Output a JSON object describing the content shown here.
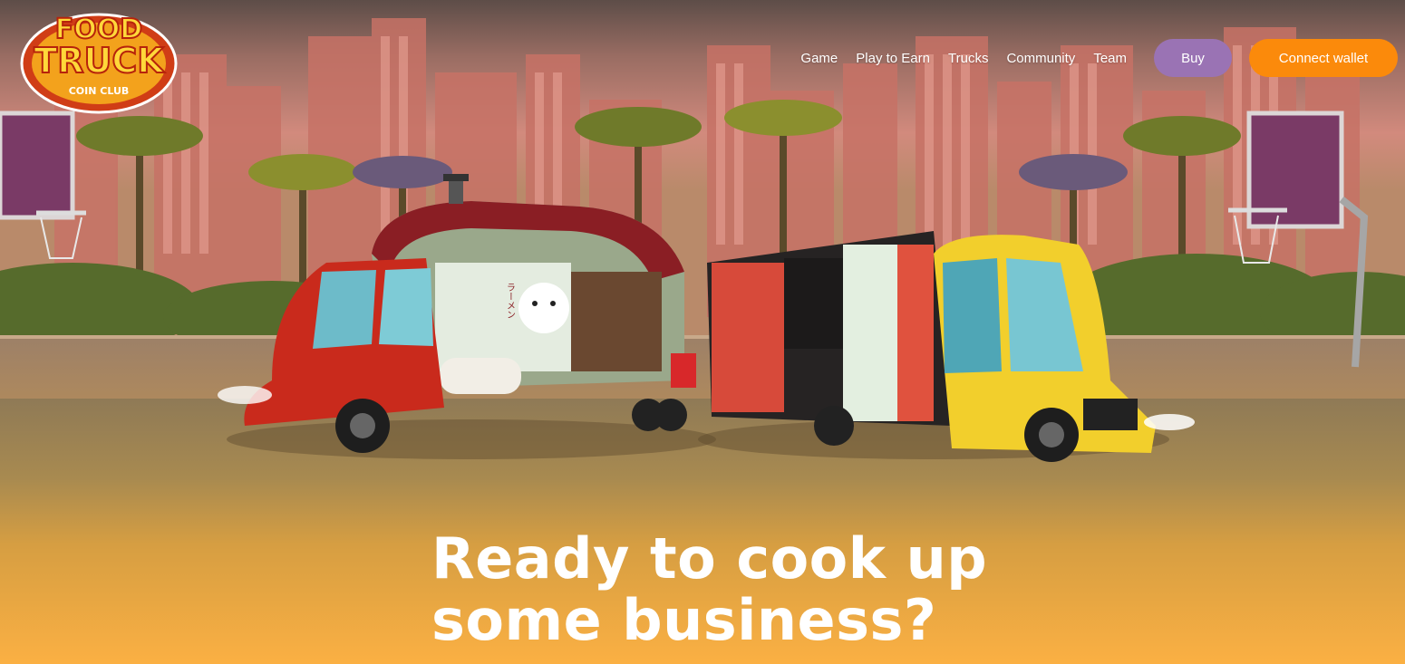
{
  "logo": {
    "line1": "FOOD",
    "line2": "TRUCK",
    "line3": "COIN CLUB"
  },
  "nav": {
    "links": [
      "Game",
      "Play to Earn",
      "Trucks",
      "Community",
      "Team"
    ],
    "buy_label": "Buy",
    "connect_label": "Connect wallet"
  },
  "hero": {
    "title_line1": "Ready to cook up",
    "title_line2": "some business?"
  },
  "truck_signage": {
    "ramen_sign": "ラーメン"
  },
  "colors": {
    "accent_orange": "#fb8a0b",
    "buy_purple": "#9a73b4",
    "hero_bottom": "#f9b040",
    "sky_top": "#5a4a44"
  }
}
